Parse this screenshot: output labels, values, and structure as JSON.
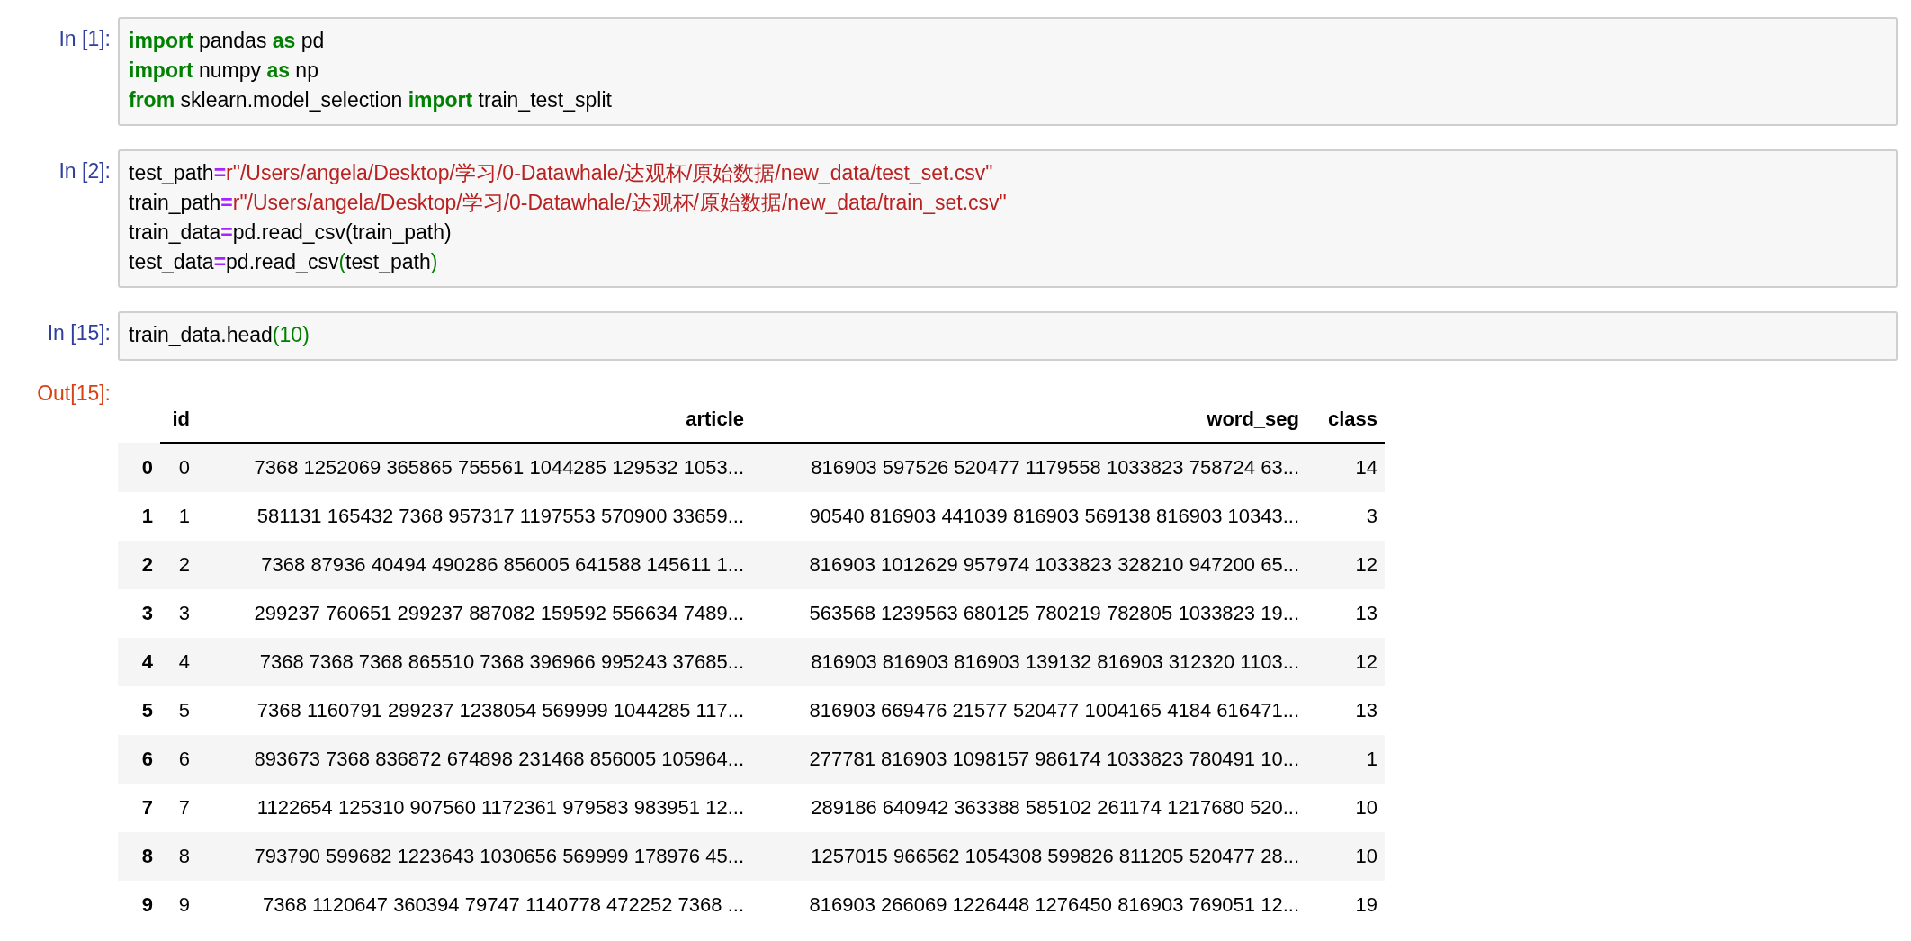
{
  "cells": [
    {
      "prompt": "In [1]:",
      "lines": [
        [
          {
            "kind": "keyword",
            "text": "import"
          },
          {
            "kind": "plain",
            "text": " pandas "
          },
          {
            "kind": "keyword",
            "text": "as"
          },
          {
            "kind": "plain",
            "text": " pd"
          }
        ],
        [
          {
            "kind": "keyword",
            "text": "import"
          },
          {
            "kind": "plain",
            "text": " numpy "
          },
          {
            "kind": "keyword",
            "text": "as"
          },
          {
            "kind": "plain",
            "text": " np"
          }
        ],
        [
          {
            "kind": "keyword",
            "text": "from"
          },
          {
            "kind": "plain",
            "text": " sklearn.model_selection "
          },
          {
            "kind": "keyword",
            "text": "import"
          },
          {
            "kind": "plain",
            "text": " train_test_split"
          }
        ]
      ]
    },
    {
      "prompt": "In [2]:",
      "lines": [
        [
          {
            "kind": "plain",
            "text": "test_path"
          },
          {
            "kind": "operator",
            "text": "="
          },
          {
            "kind": "string",
            "text": "r\"/Users/angela/Desktop/学习/0-Datawhale/达观杯/原始数据/new_data/test_set.csv\""
          }
        ],
        [
          {
            "kind": "plain",
            "text": "train_path"
          },
          {
            "kind": "operator",
            "text": "="
          },
          {
            "kind": "string",
            "text": "r\"/Users/angela/Desktop/学习/0-Datawhale/达观杯/原始数据/new_data/train_set.csv\""
          }
        ],
        [
          {
            "kind": "plain",
            "text": "train_data"
          },
          {
            "kind": "operator",
            "text": "="
          },
          {
            "kind": "plain",
            "text": "pd.read_csv(train_path)"
          }
        ],
        [
          {
            "kind": "plain",
            "text": "test_data"
          },
          {
            "kind": "operator",
            "text": "="
          },
          {
            "kind": "plain",
            "text": "pd.read_csv"
          },
          {
            "kind": "bracket",
            "text": "("
          },
          {
            "kind": "plain",
            "text": "test_path"
          },
          {
            "kind": "bracket",
            "text": ")"
          }
        ]
      ]
    },
    {
      "prompt": "In [15]:",
      "lines": [
        [
          {
            "kind": "plain",
            "text": "train_data.head"
          },
          {
            "kind": "bracket",
            "text": "("
          },
          {
            "kind": "number",
            "text": "10"
          },
          {
            "kind": "bracket",
            "text": ")"
          }
        ]
      ]
    }
  ],
  "output": {
    "prompt": "Out[15]:",
    "table": {
      "columns": [
        "id",
        "article",
        "word_seg",
        "class"
      ],
      "rows": [
        {
          "index": "0",
          "cells": [
            "0",
            "7368 1252069 365865 755561 1044285 129532 1053...",
            "816903 597526 520477 1179558 1033823 758724 63...",
            "14"
          ]
        },
        {
          "index": "1",
          "cells": [
            "1",
            "581131 165432 7368 957317 1197553 570900 33659...",
            "90540 816903 441039 816903 569138 816903 10343...",
            "3"
          ]
        },
        {
          "index": "2",
          "cells": [
            "2",
            "7368 87936 40494 490286 856005 641588 145611 1...",
            "816903 1012629 957974 1033823 328210 947200 65...",
            "12"
          ]
        },
        {
          "index": "3",
          "cells": [
            "3",
            "299237 760651 299237 887082 159592 556634 7489...",
            "563568 1239563 680125 780219 782805 1033823 19...",
            "13"
          ]
        },
        {
          "index": "4",
          "cells": [
            "4",
            "7368 7368 7368 865510 7368 396966 995243 37685...",
            "816903 816903 816903 139132 816903 312320 1103...",
            "12"
          ]
        },
        {
          "index": "5",
          "cells": [
            "5",
            "7368 1160791 299237 1238054 569999 1044285 117...",
            "816903 669476 21577 520477 1004165 4184 616471...",
            "13"
          ]
        },
        {
          "index": "6",
          "cells": [
            "6",
            "893673 7368 836872 674898 231468 856005 105964...",
            "277781 816903 1098157 986174 1033823 780491 10...",
            "1"
          ]
        },
        {
          "index": "7",
          "cells": [
            "7",
            "1122654 125310 907560 1172361 979583 983951 12...",
            "289186 640942 363388 585102 261174 1217680 520...",
            "10"
          ]
        },
        {
          "index": "8",
          "cells": [
            "8",
            "793790 599682 1223643 1030656 569999 178976 45...",
            "1257015 966562 1054308 599826 811205 520477 28...",
            "10"
          ]
        },
        {
          "index": "9",
          "cells": [
            "9",
            "7368 1120647 360394 79747 1140778 472252 7368 ...",
            "816903 266069 1226448 1276450 816903 769051 12...",
            "19"
          ]
        }
      ]
    }
  }
}
